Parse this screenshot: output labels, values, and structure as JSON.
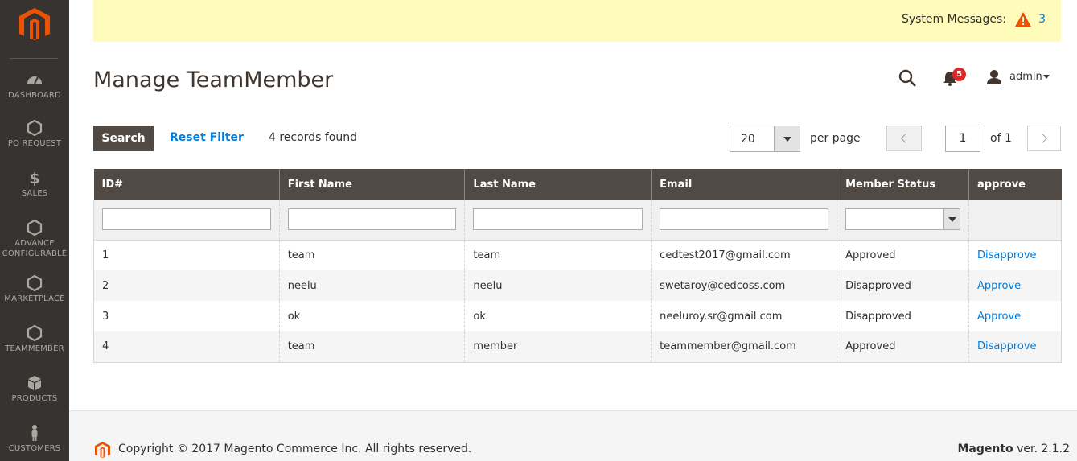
{
  "sidebar": {
    "items": [
      {
        "label": "DASHBOARD",
        "icon": "dashboard-icon"
      },
      {
        "label": "PO REQUEST",
        "icon": "hexagon-icon"
      },
      {
        "label": "SALES",
        "icon": "dollar-icon"
      },
      {
        "label": "ADVANCE CONFIGURABLE",
        "icon": "hexagon-icon"
      },
      {
        "label": "MARKETPLACE",
        "icon": "hexagon-icon"
      },
      {
        "label": "TEAMMEMBER",
        "icon": "hexagon-icon"
      },
      {
        "label": "PRODUCTS",
        "icon": "box-icon"
      },
      {
        "label": "CUSTOMERS",
        "icon": "person-icon"
      }
    ]
  },
  "system_messages": {
    "label": "System Messages:",
    "count": "3"
  },
  "header": {
    "title": "Manage TeamMember",
    "notification_count": "5",
    "user_name": "admin"
  },
  "toolbar": {
    "search_label": "Search",
    "reset_filter_label": "Reset Filter",
    "records_found": "4 records found",
    "per_page_value": "20",
    "per_page_label": "per page",
    "current_page": "1",
    "total_pages_label": "of 1"
  },
  "grid": {
    "columns": [
      "ID#",
      "First Name",
      "Last Name",
      "Email",
      "Member Status",
      "approve"
    ],
    "rows": [
      {
        "id": "1",
        "first_name": "team",
        "last_name": "team",
        "email": "cedtest2017@gmail.com",
        "status": "Approved",
        "action": "Disapprove"
      },
      {
        "id": "2",
        "first_name": "neelu",
        "last_name": "neelu",
        "email": "swetaroy@cedcoss.com",
        "status": "Disapproved",
        "action": "Approve"
      },
      {
        "id": "3",
        "first_name": "ok",
        "last_name": "ok",
        "email": "neeluroy.sr@gmail.com",
        "status": "Disapproved",
        "action": "Approve"
      },
      {
        "id": "4",
        "first_name": "team",
        "last_name": "member",
        "email": "teammember@gmail.com",
        "status": "Approved",
        "action": "Disapprove"
      }
    ]
  },
  "footer": {
    "copyright": "Copyright © 2017 Magento Commerce Inc. All rights reserved.",
    "brand": "Magento",
    "version": " ver. 2.1.2"
  },
  "colors": {
    "sidebar_bg": "#373330",
    "accent_orange": "#eb5202",
    "table_header_bg": "#514943",
    "link_blue": "#007bdb",
    "system_bar_bg": "#fffbbb"
  }
}
